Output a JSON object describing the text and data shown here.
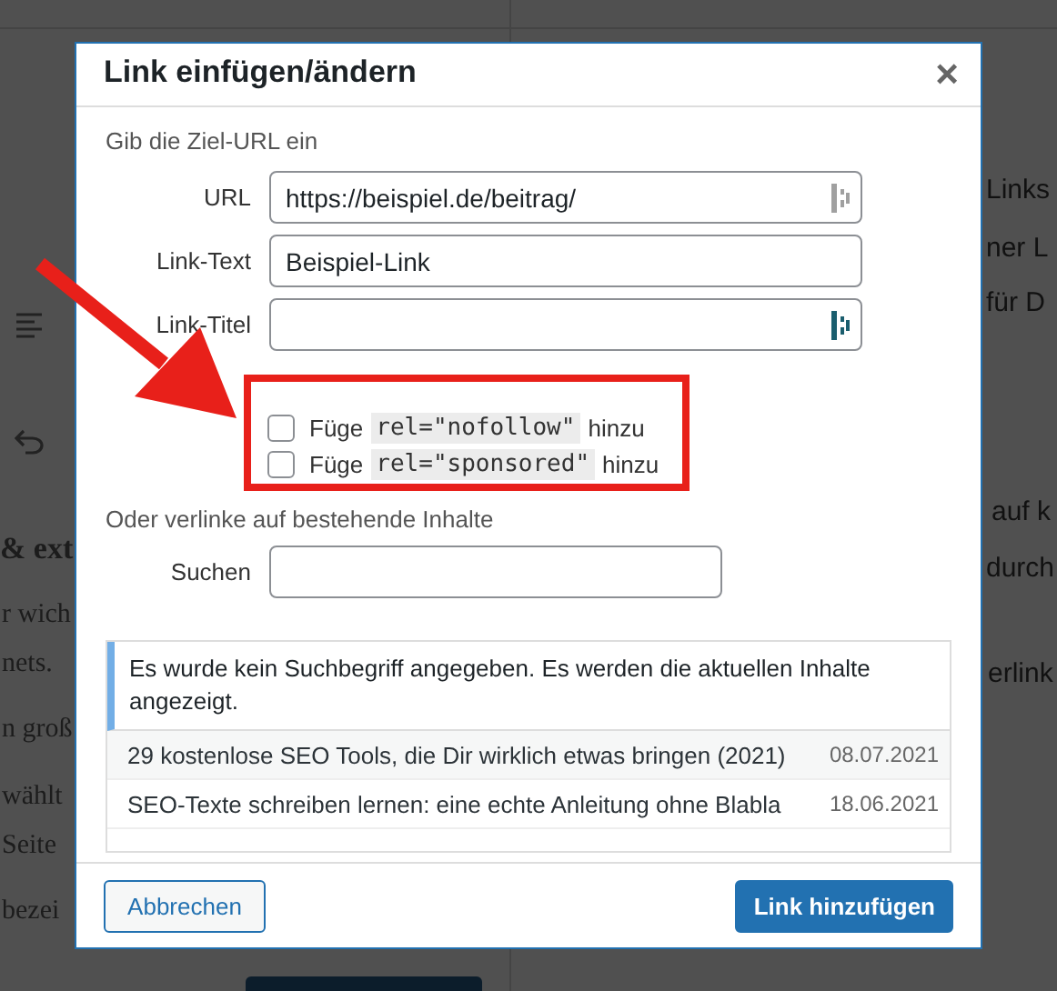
{
  "backdrop": {
    "left_texts": [
      {
        "text": "& ext",
        "kind": "heading"
      },
      {
        "text": "r wich",
        "kind": "body"
      },
      {
        "text": "nets.",
        "kind": "body"
      },
      {
        "text": "n groß",
        "kind": "body"
      },
      {
        "text": "wählt",
        "kind": "body"
      },
      {
        "text": "Seite",
        "kind": "body"
      },
      {
        "text": "bezei",
        "kind": "body"
      }
    ],
    "right_texts": [
      "Links",
      "ner L",
      "für D",
      "auf k",
      "durch",
      "erlink"
    ]
  },
  "dialog": {
    "title": "Link einfügen/ändern",
    "close": "×",
    "url_intro": "Gib die Ziel-URL ein",
    "fields": [
      {
        "label": "URL",
        "value": "https://beispiel.de/beitrag/",
        "kind": "url"
      },
      {
        "label": "Link-Text",
        "value": "Beispiel-Link",
        "kind": "text"
      },
      {
        "label": "Link-Titel",
        "kind": "title"
      }
    ],
    "options": [
      {
        "prefix": "Füge",
        "code": "rel=\"nofollow\"",
        "suffix": "hinzu",
        "checked": false
      },
      {
        "prefix": "Füge",
        "code": "rel=\"sponsored\"",
        "suffix": "hinzu",
        "checked": false
      }
    ],
    "search_intro": "Oder verlinke auf bestehende Inhalte",
    "search": {
      "label": "Suchen"
    },
    "notice": "Es wurde kein Suchbegriff angegeben. Es werden die aktuellen Inhalte angezeigt.",
    "results": [
      {
        "title": "29 kostenlose SEO Tools, die Dir wirklich etwas bringen (2021)",
        "date": "08.07.2021"
      },
      {
        "title": "SEO-Texte schreiben lernen: eine echte Anleitung ohne Blabla",
        "date": "18.06.2021"
      }
    ],
    "buttons": {
      "cancel": "Abbrechen",
      "submit": "Link hinzufügen"
    }
  }
}
